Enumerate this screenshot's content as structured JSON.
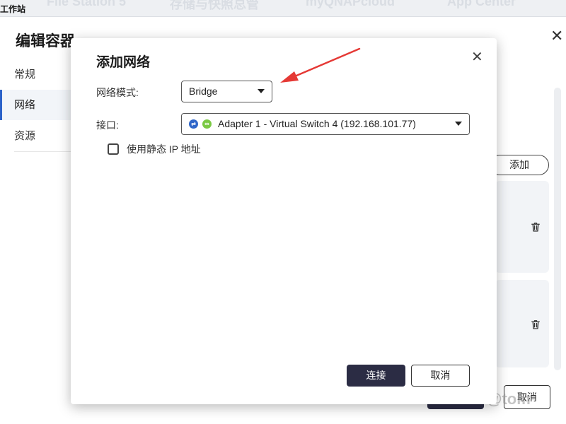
{
  "taskbar": {
    "workstation": "工作站",
    "apps": [
      "File Station 5",
      "存储与快照总管",
      "myQNAPcloud",
      "App Center"
    ]
  },
  "editor": {
    "title": "编辑容器",
    "nav": [
      {
        "label": "常规"
      },
      {
        "label": "网络",
        "active": true
      },
      {
        "label": "资源"
      }
    ],
    "add_button": "添加",
    "footer_cancel": "取消",
    "watermark": "@tom"
  },
  "dialog": {
    "title": "添加网络",
    "network_mode_label": "网络模式:",
    "network_mode_value": "Bridge",
    "interface_label": "接口:",
    "interface_value": "Adapter 1 - Virtual Switch 4 (192.168.101.77)",
    "static_ip_label": "使用静态 IP 地址",
    "static_ip_checked": false,
    "connect_button": "连接",
    "cancel_button": "取消"
  },
  "colors": {
    "accent": "#2b62c9",
    "primary_button": "#2b2c44",
    "annotation_arrow": "#e53935",
    "adapter_icon_blue": "#2f66c9",
    "adapter_icon_green": "#7ac943"
  },
  "icons": [
    "close-icon",
    "trash-icon",
    "caret-down-icon",
    "network-adapter-icon",
    "link-icon",
    "checkbox-icon",
    "annotation-arrow"
  ]
}
